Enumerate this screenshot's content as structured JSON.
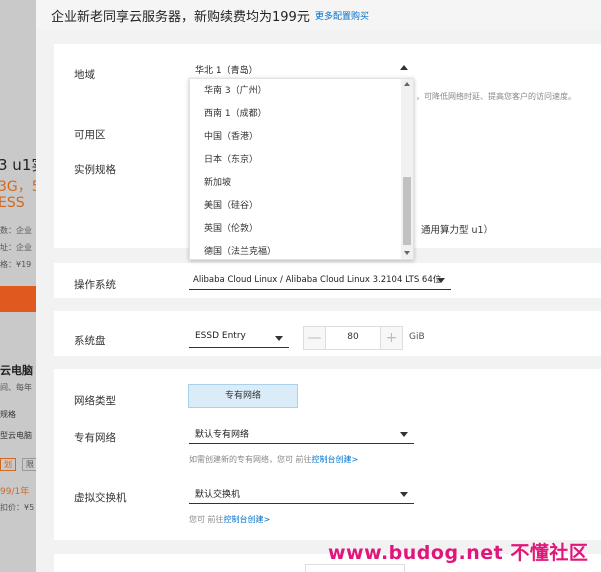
{
  "header": {
    "title": "企业新老同享云服务器，新购续费均为199元",
    "more_link": "更多配置购买"
  },
  "background_panel": {
    "heading_fragment": "3 u1实",
    "spec_fragment": "3G，5",
    "disk_fragment": "ESS",
    "row1": "数：企业",
    "row2": "址：企业",
    "row3": "格：¥19",
    "section2_title": "云电脑",
    "section2_sub": "间、每年",
    "section2_spec": "规格",
    "section2_name": "型云电脑",
    "tag1": "划",
    "tag2": "限",
    "price": "99/1年",
    "discount": "扣价：¥5"
  },
  "region": {
    "label": "地域",
    "selected": "华北 1（青岛）",
    "hint_fragment": "，可降低网络时延、提高您客户的访问速度。",
    "options": [
      "华南 3（广州）",
      "西南 1（成都）",
      "中国（香港）",
      "日本（东京）",
      "新加坡",
      "美国（硅谷）",
      "英国（伦敦）",
      "德国（法兰克福）"
    ]
  },
  "zone": {
    "label": "可用区"
  },
  "instance": {
    "label": "实例规格",
    "behind_text": "通用算力型 u1）"
  },
  "os": {
    "label": "操作系统",
    "selected": "Alibaba Cloud Linux / Alibaba Cloud Linux 3.2104 LTS 64位"
  },
  "disk": {
    "label": "系统盘",
    "type": "ESSD Entry",
    "size": "80",
    "unit": "GiB",
    "minus": "—",
    "plus": "+"
  },
  "network_type": {
    "label": "网络类型",
    "option": "专有网络"
  },
  "vpc": {
    "label": "专有网络",
    "selected": "默认专有网络",
    "hint_prefix": "如需创建新的专有网络，您可 前往",
    "hint_link": "控制台创建>"
  },
  "vswitch": {
    "label": "虚拟交换机",
    "selected": "默认交换机",
    "hint_prefix": "您可 前往",
    "hint_link": "控制台创建>"
  },
  "watermark": "www.budog.net 不懂社区"
}
